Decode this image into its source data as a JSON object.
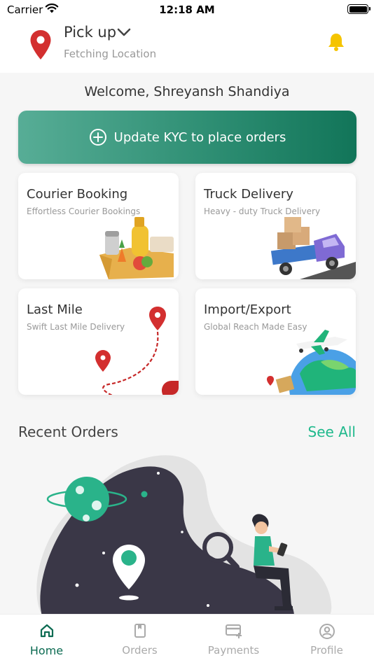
{
  "status_bar": {
    "carrier": "Carrier",
    "time": "12:18 AM"
  },
  "header": {
    "pickup_label": "Pick up",
    "location_status": "Fetching Location"
  },
  "welcome": "Welcome, Shreyansh Shandiya",
  "kyc_banner": {
    "label": "Update KYC to place orders"
  },
  "services": [
    {
      "title": "Courier Booking",
      "subtitle": "Effortless Courier Bookings"
    },
    {
      "title": "Truck Delivery",
      "subtitle": "Heavy - duty Truck Delivery"
    },
    {
      "title": "Last Mile",
      "subtitle": "Swift Last Mile Delivery"
    },
    {
      "title": "Import/Export",
      "subtitle": "Global Reach Made Easy"
    }
  ],
  "recent_orders": {
    "title": "Recent Orders",
    "see_all": "See All"
  },
  "tabs": [
    {
      "label": "Home",
      "icon": "home-icon",
      "active": true
    },
    {
      "label": "Orders",
      "icon": "orders-icon",
      "active": false
    },
    {
      "label": "Payments",
      "icon": "payments-icon",
      "active": false
    },
    {
      "label": "Profile",
      "icon": "profile-icon",
      "active": false
    }
  ],
  "colors": {
    "accent": "#1fb98c",
    "brand_dark": "#0c6b52",
    "pin": "#d32f2f",
    "bell": "#f5c400"
  }
}
